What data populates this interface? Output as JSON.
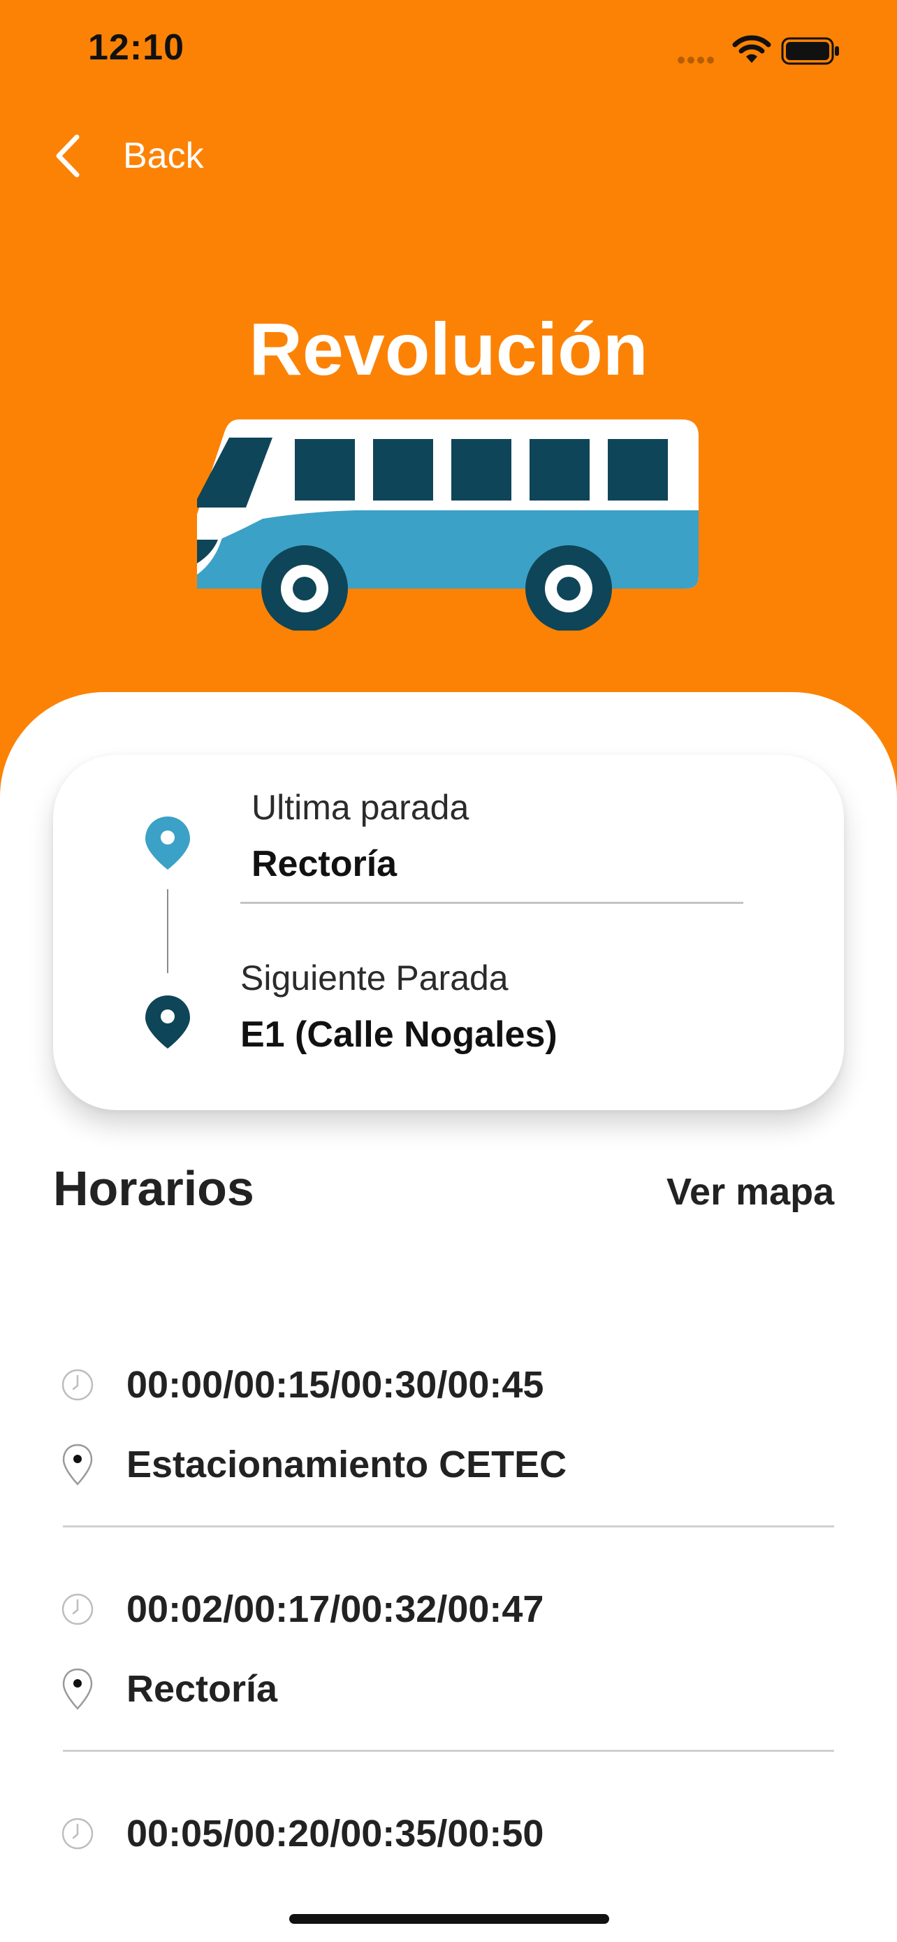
{
  "status_bar": {
    "time": "12:10"
  },
  "nav": {
    "back_label": "Back"
  },
  "route": {
    "title": "Revolución"
  },
  "stop_card": {
    "last_stop_label": "Ultima parada",
    "last_stop_value": "Rectoría",
    "next_stop_label": "Siguiente Parada",
    "next_stop_value": "E1 (Calle Nogales)"
  },
  "schedule": {
    "heading": "Horarios",
    "map_link": "Ver mapa",
    "items": [
      {
        "times": "00:00/00:15/00:30/00:45",
        "stop": "Estacionamiento CETEC"
      },
      {
        "times": "00:02/00:17/00:32/00:47",
        "stop": "Rectoría"
      },
      {
        "times": "00:05/00:20/00:35/00:50",
        "stop": ""
      }
    ]
  },
  "colors": {
    "header_orange": "#FC8205",
    "pin_light_blue": "#3CA1C6",
    "pin_dark_blue": "#0F4558",
    "bus_blue": "#3CA1C6",
    "bus_dark": "#0F4558"
  },
  "icons": {
    "back": "chevron-left-icon",
    "wifi": "wifi-icon",
    "battery": "battery-icon",
    "bus": "bus-icon",
    "clock": "clock-icon",
    "pin": "map-pin-icon"
  }
}
